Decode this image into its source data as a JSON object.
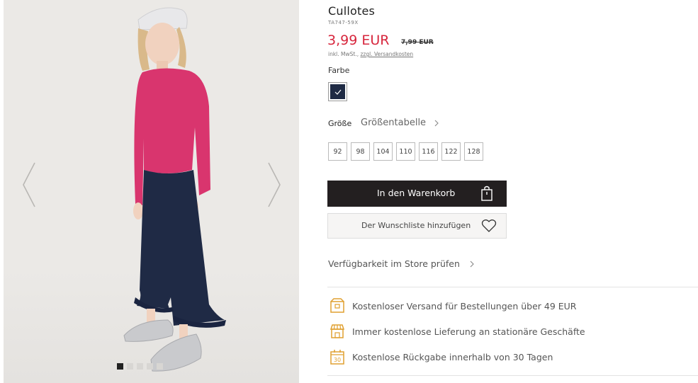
{
  "product": {
    "title": "Cullotes",
    "sku": "TA747-59X",
    "price": "3,99 EUR",
    "old_price": "7,99 EUR",
    "tax_note": "inkl. MwSt., ",
    "shipping_link": "zzgl. Versandkosten"
  },
  "color": {
    "label": "Farbe",
    "selected_swatch": "#1e2a44"
  },
  "size": {
    "label": "Größe",
    "table_link": "Größentabelle",
    "options": [
      "92",
      "98",
      "104",
      "110",
      "116",
      "122",
      "128"
    ]
  },
  "actions": {
    "add_to_cart": "In den Warenkorb",
    "wishlist": "Der Wunschliste hinzufügen",
    "store_availability": "Verfügbarkeit im Store prüfen"
  },
  "benefits": [
    {
      "icon": "truck-box-icon",
      "text": "Kostenloser Versand für Bestellungen über 49 EUR"
    },
    {
      "icon": "store-icon",
      "text": "Immer kostenlose Lieferung an stationäre Geschäfte"
    },
    {
      "icon": "calendar-30-icon",
      "text": "Kostenlose Rückgabe innerhalb von 30 Tagen"
    }
  ],
  "gallery": {
    "active_index": 0,
    "image_count": 5
  },
  "colors": {
    "accent_price": "#d7263d",
    "cart_button": "#231f20",
    "benefit_icon": "#e0a030"
  }
}
